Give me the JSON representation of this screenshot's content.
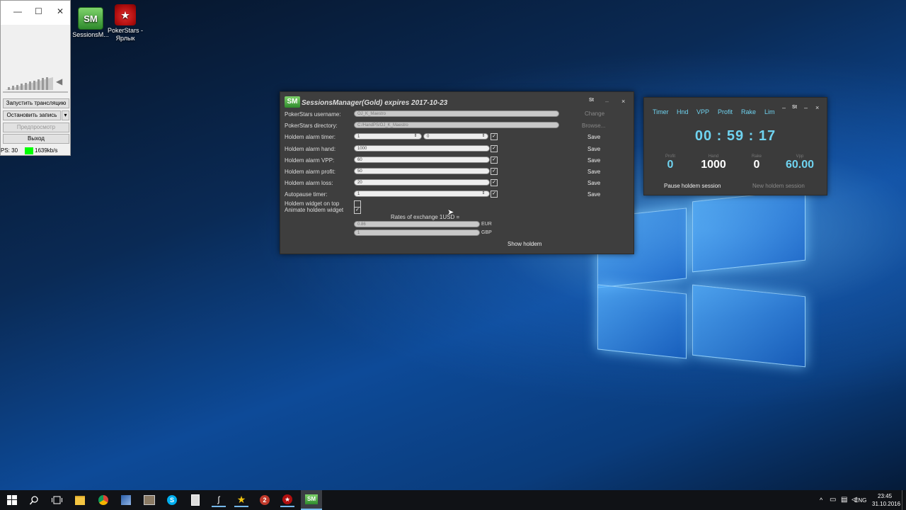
{
  "desktop": {
    "icons": [
      {
        "label": "SessionsM...",
        "icon": "sessionsmanager-icon"
      },
      {
        "label": "PokerStars - Ярлык",
        "icon": "pokerstars-icon"
      }
    ]
  },
  "left_window": {
    "buttons": [
      {
        "label": "Запустить трансляцию"
      },
      {
        "label": "Остановить запись"
      },
      {
        "label": "Предпросмотр"
      },
      {
        "label": "Выход"
      }
    ],
    "status_fps": "PS: 30",
    "status_bitrate": "1639kb/s",
    "status_color": "#00ff00"
  },
  "sessions_manager": {
    "title": "SessionsManager(Gold) expires 2017-10-23",
    "logo": "SM",
    "window_controls": {
      "st": "St",
      "minimize": "–",
      "close": "×"
    },
    "rows": [
      {
        "label": "PokerStars username:",
        "value": "OJ_K_Maestro",
        "action": "Change"
      },
      {
        "label": "PokerStars directory:",
        "value": "C:/HandPS/OJ_K_Maestro",
        "action": "Browse..."
      },
      {
        "label": "Holdem alarm timer:",
        "value": "1",
        "value2": "0",
        "action": "Save"
      },
      {
        "label": "Holdem alarm hand:",
        "value": "1000",
        "action": "Save"
      },
      {
        "label": "Holdem alarm VPP:",
        "value": "60",
        "action": "Save"
      },
      {
        "label": "Holdem alarm profit:",
        "value": "50",
        "action": "Save"
      },
      {
        "label": "Holdem alarm loss:",
        "value": "20",
        "action": "Save"
      },
      {
        "label": "Autopause timer:",
        "value": "1",
        "action": "Save"
      }
    ],
    "widget_on_top_label": "Holdem widget on top",
    "animate_widget_label": "Animate holdem widget",
    "rates_label": "Rates of exchange 1USD =",
    "rates": [
      {
        "value": "0.86",
        "currency": "EUR"
      },
      {
        "value": "1",
        "currency": "GBP"
      }
    ],
    "show_holdem": "Show holdem"
  },
  "holdem_widget": {
    "tabs": [
      "Timer",
      "Hnd",
      "VPP",
      "Profit",
      "Rake",
      "Lim"
    ],
    "controls": {
      "minimize1": "–",
      "st": "St",
      "minimize2": "–",
      "close": "×"
    },
    "clock": "00 : 59 : 17",
    "stats": [
      {
        "caption": "Profit",
        "value": "0",
        "color": "#6fd3f0"
      },
      {
        "caption": "Hand",
        "value": "1000",
        "color": "#ffffff"
      },
      {
        "caption": "Rake",
        "value": "0",
        "color": "#ffffff"
      },
      {
        "caption": "Vpp",
        "value": "60.00",
        "color": "#6fd3f0"
      }
    ],
    "pause_label": "Pause holdem session",
    "new_label": "New holdem session"
  },
  "taskbar": {
    "language": "ENG",
    "time": "23:45",
    "date": "31.10.2016"
  }
}
